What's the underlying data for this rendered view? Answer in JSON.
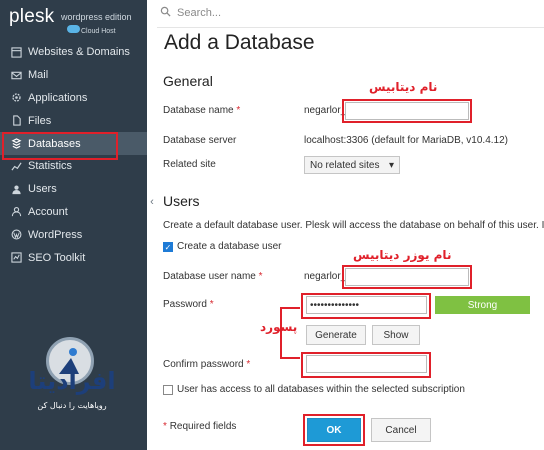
{
  "logo": {
    "name": "plesk",
    "edition": "wordpress edition",
    "host": "Cloud Host"
  },
  "search": {
    "placeholder": "Search..."
  },
  "sidebar": {
    "items": [
      {
        "label": "Websites & Domains",
        "icon": "globe-icon"
      },
      {
        "label": "Mail",
        "icon": "mail-icon"
      },
      {
        "label": "Applications",
        "icon": "gear-icon"
      },
      {
        "label": "Files",
        "icon": "file-icon"
      },
      {
        "label": "Databases",
        "icon": "database-icon",
        "active": true
      },
      {
        "label": "Statistics",
        "icon": "chart-icon"
      },
      {
        "label": "Users",
        "icon": "user-icon"
      },
      {
        "label": "Account",
        "icon": "account-icon"
      },
      {
        "label": "WordPress",
        "icon": "wordpress-icon"
      },
      {
        "label": "SEO Toolkit",
        "icon": "seo-icon"
      }
    ]
  },
  "badge": {
    "title": "افرادیتا",
    "subtitle": "رویاهایت را دنبال کن"
  },
  "page": {
    "title": "Add a Database"
  },
  "general": {
    "heading": "General",
    "db_name_label": "Database name",
    "db_name_prefix": "negarlor_",
    "db_server_label": "Database server",
    "db_server_value": "localhost:3306 (default for MariaDB, v10.4.12)",
    "related_site_label": "Related site",
    "related_site_value": "No related sites"
  },
  "users": {
    "heading": "Users",
    "description": "Create a default database user. Plesk will access the database on behalf of this user. If no",
    "create_user_label": "Create a database user",
    "user_name_label": "Database user name",
    "user_name_prefix": "negarlor_",
    "password_label": "Password",
    "password_value": "••••••••••••••",
    "strength": "Strong",
    "generate_label": "Generate",
    "show_label": "Show",
    "confirm_label": "Confirm password",
    "all_dbs_label": "User has access to all databases within the selected subscription"
  },
  "footer": {
    "required": "Required fields",
    "ok": "OK",
    "cancel": "Cancel"
  },
  "annotations": {
    "db_name": "نام دیتابیس",
    "db_user": "نام یوزر دیتابیس",
    "password": "پسورد"
  },
  "colors": {
    "sidebar": "#2f3d4a",
    "accent": "#1e9ad6",
    "annotation": "#e0202a",
    "strength": "#7fc142"
  }
}
